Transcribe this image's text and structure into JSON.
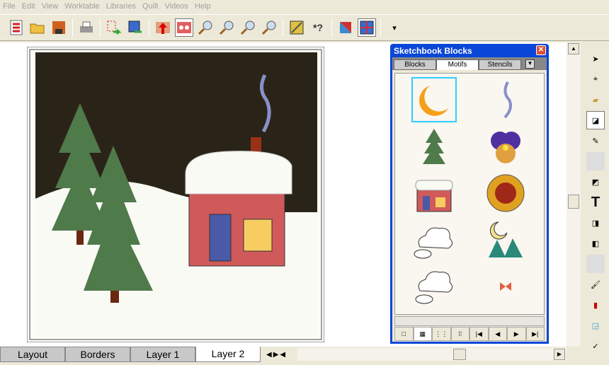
{
  "menu": [
    "File",
    "Edit",
    "View",
    "Worktable",
    "Libraries",
    "Quilt",
    "Videos",
    "Help"
  ],
  "toolbar": {
    "icons": [
      "new-icon",
      "open-icon",
      "save-icon",
      "print-icon",
      "send-to-sketchbook-icon",
      "add-to-sketchbook-icon",
      "export-icon",
      "view-sketchbook-icon",
      "zoom-in-icon",
      "zoom-out-icon",
      "zoom-actual-icon",
      "fit-to-window-icon",
      "fussy-cut-icon",
      "help-pointer-icon",
      "block-worktable-icon",
      "quilt-worktable-icon"
    ]
  },
  "palette": {
    "title": "Sketchbook Blocks",
    "close": "✕",
    "tabs": [
      "Blocks",
      "Motifs",
      "Stencils"
    ],
    "active_tab": "Motifs",
    "items": [
      "moon",
      "smoke",
      "tree",
      "pansy",
      "house",
      "sunflower",
      "cloud",
      "night-scene",
      "cloud-small",
      "butterfly"
    ],
    "selected": "moon"
  },
  "tabs": [
    "Layout",
    "Borders",
    "Layer 1",
    "Layer 2"
  ],
  "active_tab": "Layer 2",
  "colors": {
    "sky": "#2a2418",
    "moon": "#f5a01a",
    "tree": "#4f7a4a",
    "house": "#d05a5a",
    "door": "#4a5aa8",
    "window": "#f8cc60",
    "chimney": "#9a3018",
    "snow": "#fafaf5"
  }
}
